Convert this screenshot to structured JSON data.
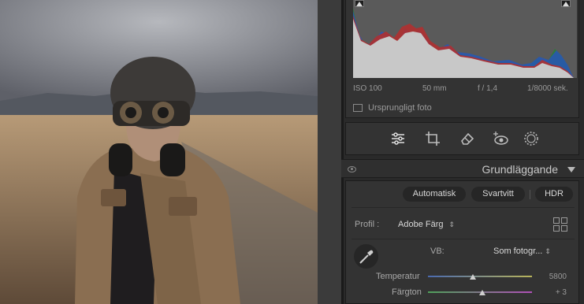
{
  "photo": {
    "icon": "portrait-photo"
  },
  "histogram": {
    "iso": "ISO 100",
    "focal": "50 mm",
    "aperture": "f / 1,4",
    "shutter": "1/8000 sek.",
    "original_label": "Ursprungligt foto"
  },
  "tools": [
    "sliders-icon",
    "crop-icon",
    "eraser-icon",
    "redeye-icon",
    "mask-icon"
  ],
  "basic_panel": {
    "title": "Grundläggande",
    "auto_label": "Automatisk",
    "bw_label": "Svartvitt",
    "hdr_label": "HDR",
    "profile_label": "Profil :",
    "profile_value": "Adobe Färg",
    "wb_label": "VB:",
    "wb_value": "Som fotogr... ",
    "sliders": [
      {
        "label": "Temperatur",
        "value": "5800",
        "position": 0.43
      },
      {
        "label": "Färgton",
        "value": "+ 3",
        "position": 0.52
      }
    ]
  },
  "colors": {
    "panel_bg": "#333333",
    "header_bg": "#2f2f2f",
    "accent": "#d8d8d8"
  }
}
